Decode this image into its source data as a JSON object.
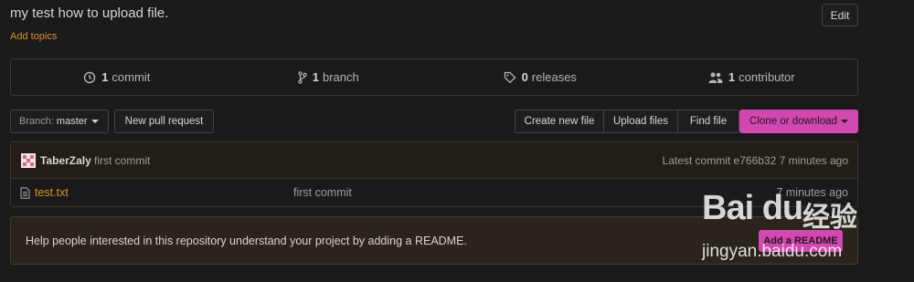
{
  "repo": {
    "description": "my test how to upload file.",
    "add_topics": "Add topics",
    "edit_label": "Edit"
  },
  "numbers_summary": {
    "commits": {
      "count": "1",
      "label": "commit"
    },
    "branches": {
      "count": "1",
      "label": "branch"
    },
    "releases": {
      "count": "0",
      "label": "releases"
    },
    "contributors": {
      "count": "1",
      "label": "contributor"
    }
  },
  "toolbar": {
    "branch_prefix": "Branch:",
    "branch_name": "master",
    "new_pull_request": "New pull request",
    "create_new_file": "Create new file",
    "upload_files": "Upload files",
    "find_file": "Find file",
    "clone_or_download": "Clone or download"
  },
  "latest_commit": {
    "author": "TaberZaly",
    "message": "first commit",
    "summary": "Latest commit e766b32 7 minutes ago"
  },
  "files": [
    {
      "name": "test.txt",
      "message": "first commit",
      "age": "7 minutes ago"
    }
  ],
  "readme_prompt": {
    "text": "Help people interested in this repository understand your project by adding a README.",
    "button": "Add a README"
  },
  "watermark": {
    "logo": "Bai du",
    "cn": "经验",
    "url": "jingyan.baidu.com"
  },
  "colors": {
    "accent_pink": "#d347b0",
    "link_orange": "#e0902a",
    "background": "#1b1a1a"
  }
}
